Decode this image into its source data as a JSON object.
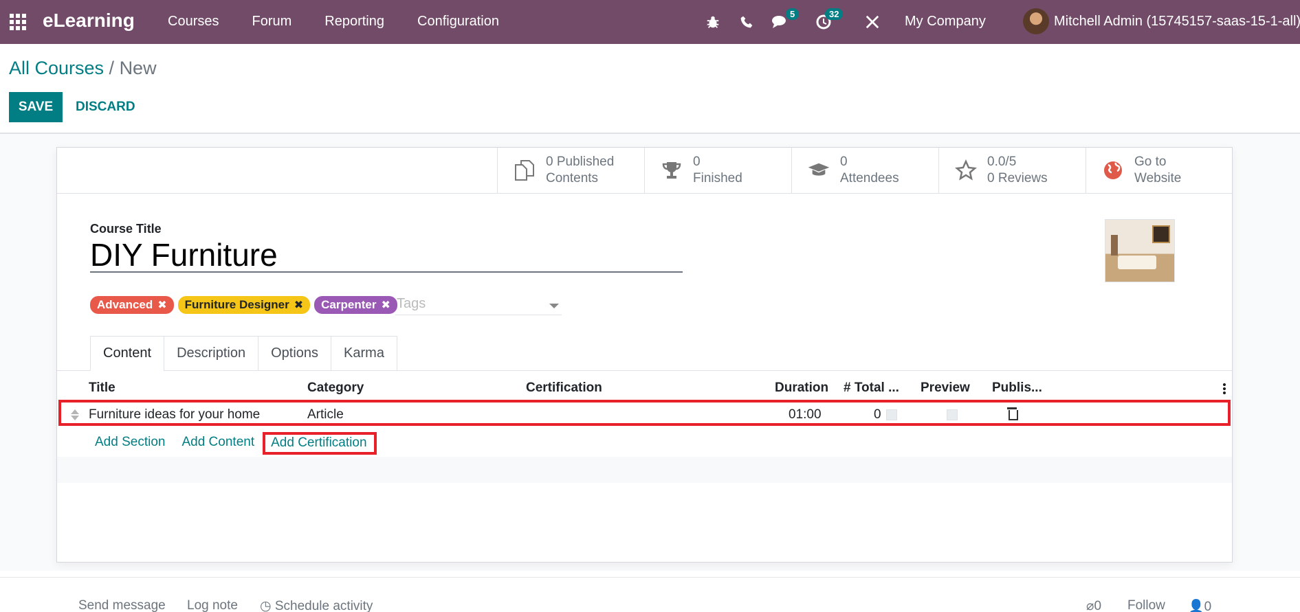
{
  "navbar": {
    "brand": "eLearning",
    "menu": [
      "Courses",
      "Forum",
      "Reporting",
      "Configuration"
    ],
    "messages_count": "5",
    "activities_count": "32",
    "company": "My Company",
    "user": "Mitchell Admin (15745157-saas-15-1-all)"
  },
  "breadcrumb": {
    "parent": "All Courses",
    "separator": " / ",
    "current": "New"
  },
  "actions": {
    "save": "SAVE",
    "discard": "DISCARD"
  },
  "smart_buttons": [
    {
      "icon": "copy-icon",
      "line1": "0 Published",
      "line2": "Contents"
    },
    {
      "icon": "trophy-icon",
      "line1": "0",
      "line2": "Finished"
    },
    {
      "icon": "graduation-cap-icon",
      "line1": "0",
      "line2": "Attendees"
    },
    {
      "icon": "star-icon",
      "line1": "0.0/5",
      "line2": "0 Reviews"
    },
    {
      "icon": "globe-icon",
      "line1": "Go to",
      "line2": "Website"
    }
  ],
  "form": {
    "title_label": "Course Title",
    "title_value": "DIY Furniture",
    "tags": [
      {
        "label": "Advanced",
        "color": "#e8594a"
      },
      {
        "label": "Furniture Designer",
        "color": "#f5c518"
      },
      {
        "label": "Carpenter",
        "color": "#9b59b6"
      }
    ],
    "tags_placeholder": "Tags"
  },
  "tabs": [
    "Content",
    "Description",
    "Options",
    "Karma"
  ],
  "table": {
    "headers": [
      "Title",
      "Category",
      "Certification",
      "Duration",
      "# Total ...",
      "Preview",
      "Publis..."
    ],
    "rows": [
      {
        "title": "Furniture ideas for your home",
        "category": "Article",
        "certification": "",
        "duration": "01:00",
        "total": "0"
      }
    ],
    "add_links": [
      "Add Section",
      "Add Content",
      "Add Certification"
    ]
  },
  "chatter": {
    "send_message": "Send message",
    "log_note": "Log note",
    "schedule_activity": "Schedule activity",
    "attachments": "0",
    "follow": "Follow",
    "followers": "0"
  },
  "colors": {
    "navbar": "#714B67",
    "primary": "#017e84",
    "highlight": "#e8202a"
  }
}
